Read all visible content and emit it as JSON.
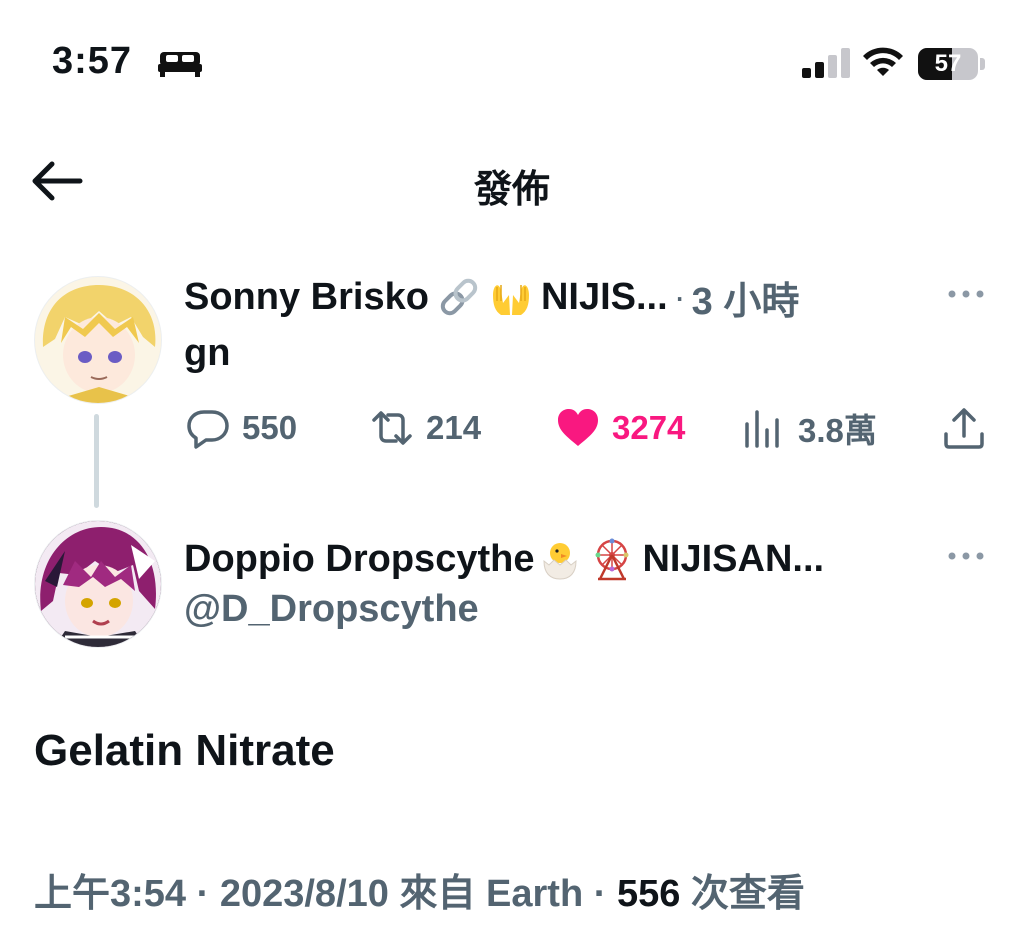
{
  "status_bar": {
    "time": "3:57",
    "battery_level": "57",
    "battery_fraction": 0.57
  },
  "header": {
    "title": "發佈",
    "back_icon": "arrow-left-icon"
  },
  "reply_to_tweet": {
    "author_name": "Sonny Brisko",
    "name_emojis": [
      "link-emoji",
      "palms-up-emoji"
    ],
    "name_suffix": "NIJIS...",
    "separator": "·",
    "time_ago": "3 小時",
    "text": "gn",
    "stats": {
      "replies": "550",
      "retweets": "214",
      "likes": "3274",
      "views": "3.8萬"
    },
    "colors": {
      "like": "#f91880",
      "muted": "#536471"
    }
  },
  "main_tweet": {
    "author_name": "Doppio Dropscythe",
    "name_emojis": [
      "hatching-chick-emoji",
      "ferris-wheel-emoji"
    ],
    "name_suffix": "NIJISAN...",
    "handle": "@D_Dropscythe",
    "text": "Gelatin Nitrate",
    "meta": {
      "time": "上午3:54",
      "sep1": "·",
      "date": "2023/8/10",
      "source": "來自 Earth",
      "sep2": "·",
      "views_count": "556",
      "views_label": "次查看"
    }
  }
}
